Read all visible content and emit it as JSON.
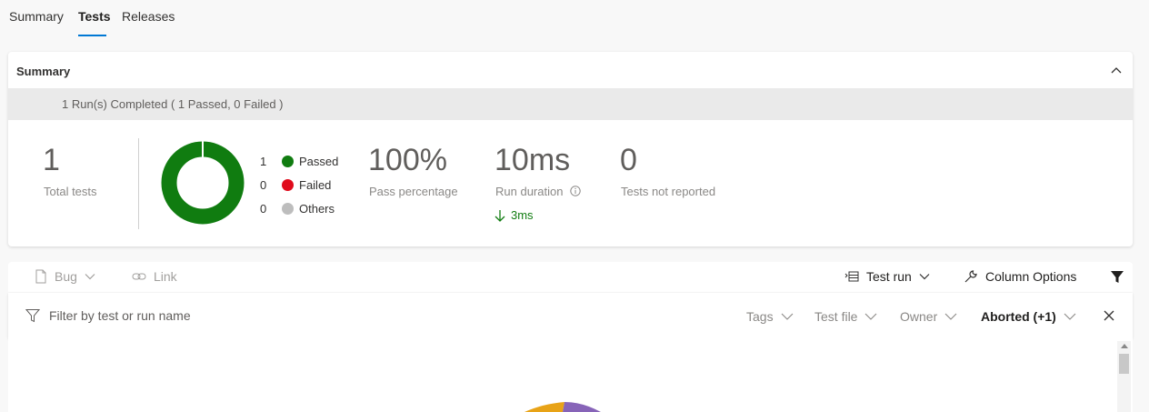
{
  "tabs": [
    {
      "label": "Summary",
      "active": false
    },
    {
      "label": "Tests",
      "active": true
    },
    {
      "label": "Releases",
      "active": false
    }
  ],
  "summary": {
    "title": "Summary",
    "banner": "1 Run(s) Completed ( 1 Passed, 0 Failed )",
    "total_tests_value": "1",
    "total_tests_label": "Total tests",
    "legend": [
      {
        "count": "1",
        "label": "Passed",
        "color": "#107c10"
      },
      {
        "count": "0",
        "label": "Failed",
        "color": "#e00b1c"
      },
      {
        "count": "0",
        "label": "Others",
        "color": "#bdbdbd"
      }
    ],
    "pass_percentage_value": "100%",
    "pass_percentage_label": "Pass percentage",
    "run_duration_value": "10ms",
    "run_duration_label": "Run duration",
    "run_duration_delta": "3ms",
    "not_reported_value": "0",
    "not_reported_label": "Tests not reported"
  },
  "toolbar": {
    "bug_label": "Bug",
    "link_label": "Link",
    "test_run_label": "Test run",
    "column_options_label": "Column Options"
  },
  "filters": {
    "search_placeholder": "Filter by test or run name",
    "tags_label": "Tags",
    "test_file_label": "Test file",
    "owner_label": "Owner",
    "outcome_label": "Aborted (+1)"
  },
  "colors": {
    "accent": "#0078d4",
    "passed": "#107c10",
    "failed": "#e00b1c",
    "others": "#bdbdbd"
  }
}
